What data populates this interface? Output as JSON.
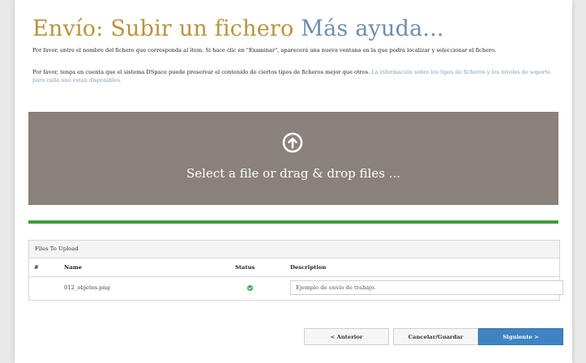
{
  "header": {
    "title_main": "Envío: Subir un fichero",
    "title_help": "Más ayuda..."
  },
  "instructions": {
    "line1": "Por favor, entre el nombre del fichero que corresponda al ítem. Si hace clic en \"Examinar\", aparecerá una nueva ventana en la que podrá localizar y seleccionar el fichero.",
    "line2": "Por favor, tenga en cuenta que el sistema DSpace puede preservar el contenido de ciertos tipos de ficheros mejor que otros.",
    "line2_link": "La información sobre los tipos de ficheros y los niveles de soporte para cada uno están disponibles."
  },
  "dropzone": {
    "text": "Select a file or drag & drop files ...",
    "icon": "circle-arrow-up-icon"
  },
  "progress": {
    "percent": 100,
    "color": "#3f9b3d"
  },
  "files": {
    "heading": "Files To Upload",
    "columns": {
      "num": "#",
      "name": "Name",
      "status": "Status",
      "description": "Description"
    },
    "rows": [
      {
        "name": "012_objetos.png",
        "status": "ok",
        "description": "Ejemplo de envío de trabajo."
      }
    ]
  },
  "buttons": {
    "prev": "< Anterior",
    "cancel": "Cancelar/Guardar",
    "next": "Siguiente >"
  },
  "colors": {
    "title_main": "#b8943f",
    "title_help": "#6f8fa8",
    "dropzone_bg": "#8b817c",
    "primary": "#3f83c2",
    "status_ok": "#35a64a"
  }
}
